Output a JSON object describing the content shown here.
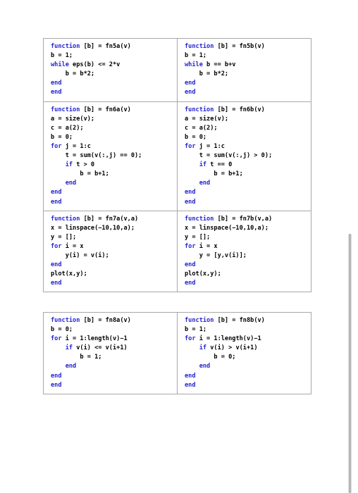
{
  "document": {
    "kind": "matlab-code-comparison-sheet",
    "background_color": "#ffffff",
    "keyword_color": "#2323cf",
    "text_color": "#000000",
    "border_color": "#a8a8a8"
  },
  "tables": {
    "upper": {
      "rows": [
        {
          "left": {
            "name": "fn5a",
            "lines": [
              {
                "segments": [
                  {
                    "t": "function",
                    "kw": true
                  },
                  {
                    "t": " [b] = fn5a(v)",
                    "kw": false
                  }
                ]
              },
              {
                "segments": [
                  {
                    "t": "b = 1;",
                    "kw": false
                  }
                ]
              },
              {
                "segments": [
                  {
                    "t": "while",
                    "kw": true
                  },
                  {
                    "t": " eps(b) <= 2*v",
                    "kw": false
                  }
                ]
              },
              {
                "segments": [
                  {
                    "t": "    b = b*2;",
                    "kw": false
                  }
                ]
              },
              {
                "segments": [
                  {
                    "t": "end",
                    "kw": true
                  }
                ]
              },
              {
                "segments": [
                  {
                    "t": "end",
                    "kw": true
                  }
                ]
              }
            ]
          },
          "right": {
            "name": "fn5b",
            "lines": [
              {
                "segments": [
                  {
                    "t": "function",
                    "kw": true
                  },
                  {
                    "t": " [b] = fn5b(v)",
                    "kw": false
                  }
                ]
              },
              {
                "segments": [
                  {
                    "t": "b = 1;",
                    "kw": false
                  }
                ]
              },
              {
                "segments": [
                  {
                    "t": "while",
                    "kw": true
                  },
                  {
                    "t": " b == b+v",
                    "kw": false
                  }
                ]
              },
              {
                "segments": [
                  {
                    "t": "    b = b*2;",
                    "kw": false
                  }
                ]
              },
              {
                "segments": [
                  {
                    "t": "end",
                    "kw": true
                  }
                ]
              },
              {
                "segments": [
                  {
                    "t": "end",
                    "kw": true
                  }
                ]
              }
            ]
          }
        },
        {
          "left": {
            "name": "fn6a",
            "lines": [
              {
                "segments": [
                  {
                    "t": "function",
                    "kw": true
                  },
                  {
                    "t": " [b] = fn6a(v)",
                    "kw": false
                  }
                ]
              },
              {
                "segments": [
                  {
                    "t": "a = size(v);",
                    "kw": false
                  }
                ]
              },
              {
                "segments": [
                  {
                    "t": "c = a(2);",
                    "kw": false
                  }
                ]
              },
              {
                "segments": [
                  {
                    "t": "b = 0;",
                    "kw": false
                  }
                ]
              },
              {
                "segments": [
                  {
                    "t": "for",
                    "kw": true
                  },
                  {
                    "t": " j = 1:c",
                    "kw": false
                  }
                ]
              },
              {
                "segments": [
                  {
                    "t": "    t = sum(v(:,j) == 0);",
                    "kw": false
                  }
                ]
              },
              {
                "segments": [
                  {
                    "t": "    ",
                    "kw": false
                  },
                  {
                    "t": "if",
                    "kw": true
                  },
                  {
                    "t": " t > 0",
                    "kw": false
                  }
                ]
              },
              {
                "segments": [
                  {
                    "t": "        b = b+1;",
                    "kw": false
                  }
                ]
              },
              {
                "segments": [
                  {
                    "t": "    ",
                    "kw": false
                  },
                  {
                    "t": "end",
                    "kw": true
                  }
                ]
              },
              {
                "segments": [
                  {
                    "t": "end",
                    "kw": true
                  }
                ]
              },
              {
                "segments": [
                  {
                    "t": "end",
                    "kw": true
                  }
                ]
              }
            ]
          },
          "right": {
            "name": "fn6b",
            "lines": [
              {
                "segments": [
                  {
                    "t": "function",
                    "kw": true
                  },
                  {
                    "t": " [b] = fn6b(v)",
                    "kw": false
                  }
                ]
              },
              {
                "segments": [
                  {
                    "t": "a = size(v);",
                    "kw": false
                  }
                ]
              },
              {
                "segments": [
                  {
                    "t": "c = a(2);",
                    "kw": false
                  }
                ]
              },
              {
                "segments": [
                  {
                    "t": "b = 0;",
                    "kw": false
                  }
                ]
              },
              {
                "segments": [
                  {
                    "t": "for",
                    "kw": true
                  },
                  {
                    "t": " j = 1:c",
                    "kw": false
                  }
                ]
              },
              {
                "segments": [
                  {
                    "t": "    t = sum(v(:,j) > 0);",
                    "kw": false
                  }
                ]
              },
              {
                "segments": [
                  {
                    "t": "    ",
                    "kw": false
                  },
                  {
                    "t": "if",
                    "kw": true
                  },
                  {
                    "t": " t == 0",
                    "kw": false
                  }
                ]
              },
              {
                "segments": [
                  {
                    "t": "        b = b+1;",
                    "kw": false
                  }
                ]
              },
              {
                "segments": [
                  {
                    "t": "    ",
                    "kw": false
                  },
                  {
                    "t": "end",
                    "kw": true
                  }
                ]
              },
              {
                "segments": [
                  {
                    "t": "end",
                    "kw": true
                  }
                ]
              },
              {
                "segments": [
                  {
                    "t": "end",
                    "kw": true
                  }
                ]
              }
            ]
          }
        },
        {
          "left": {
            "name": "fn7a",
            "lines": [
              {
                "segments": [
                  {
                    "t": "function",
                    "kw": true
                  },
                  {
                    "t": " [b] = fn7a(v,a)",
                    "kw": false
                  }
                ]
              },
              {
                "segments": [
                  {
                    "t": "x = linspace(−10,10,a);",
                    "kw": false
                  }
                ]
              },
              {
                "segments": [
                  {
                    "t": "y = [];",
                    "kw": false
                  }
                ]
              },
              {
                "segments": [
                  {
                    "t": "for",
                    "kw": true
                  },
                  {
                    "t": " i = x",
                    "kw": false
                  }
                ]
              },
              {
                "segments": [
                  {
                    "t": "    y(i) = v(i);",
                    "kw": false
                  }
                ]
              },
              {
                "segments": [
                  {
                    "t": "end",
                    "kw": true
                  }
                ]
              },
              {
                "segments": [
                  {
                    "t": "plot(x,y);",
                    "kw": false
                  }
                ]
              },
              {
                "segments": [
                  {
                    "t": "end",
                    "kw": true
                  }
                ]
              }
            ]
          },
          "right": {
            "name": "fn7b",
            "lines": [
              {
                "segments": [
                  {
                    "t": "function",
                    "kw": true
                  },
                  {
                    "t": " [b] = fn7b(v,a)",
                    "kw": false
                  }
                ]
              },
              {
                "segments": [
                  {
                    "t": "x = linspace(−10,10,a);",
                    "kw": false
                  }
                ]
              },
              {
                "segments": [
                  {
                    "t": "y = [];",
                    "kw": false
                  }
                ]
              },
              {
                "segments": [
                  {
                    "t": "for",
                    "kw": true
                  },
                  {
                    "t": " i = x",
                    "kw": false
                  }
                ]
              },
              {
                "segments": [
                  {
                    "t": "    y = [y,v(i)];",
                    "kw": false
                  }
                ]
              },
              {
                "segments": [
                  {
                    "t": "end",
                    "kw": true
                  }
                ]
              },
              {
                "segments": [
                  {
                    "t": "plot(x,y);",
                    "kw": false
                  }
                ]
              },
              {
                "segments": [
                  {
                    "t": "end",
                    "kw": true
                  }
                ]
              }
            ]
          }
        }
      ]
    },
    "lower": {
      "rows": [
        {
          "left": {
            "name": "fn8a",
            "lines": [
              {
                "segments": [
                  {
                    "t": "function",
                    "kw": true
                  },
                  {
                    "t": " [b] = fn8a(v)",
                    "kw": false
                  }
                ]
              },
              {
                "segments": [
                  {
                    "t": "b = 0;",
                    "kw": false
                  }
                ]
              },
              {
                "segments": [
                  {
                    "t": "for",
                    "kw": true
                  },
                  {
                    "t": " i = 1:length(v)−1",
                    "kw": false
                  }
                ]
              },
              {
                "segments": [
                  {
                    "t": "    ",
                    "kw": false
                  },
                  {
                    "t": "if",
                    "kw": true
                  },
                  {
                    "t": " v(i) <= v(i+1)",
                    "kw": false
                  }
                ]
              },
              {
                "segments": [
                  {
                    "t": "        b = 1;",
                    "kw": false
                  }
                ]
              },
              {
                "segments": [
                  {
                    "t": "    ",
                    "kw": false
                  },
                  {
                    "t": "end",
                    "kw": true
                  }
                ]
              },
              {
                "segments": [
                  {
                    "t": "end",
                    "kw": true
                  }
                ]
              },
              {
                "segments": [
                  {
                    "t": "end",
                    "kw": true
                  }
                ]
              }
            ]
          },
          "right": {
            "name": "fn8b",
            "lines": [
              {
                "segments": [
                  {
                    "t": "function",
                    "kw": true
                  },
                  {
                    "t": " [b] = fn8b(v)",
                    "kw": false
                  }
                ]
              },
              {
                "segments": [
                  {
                    "t": "b = 1;",
                    "kw": false
                  }
                ]
              },
              {
                "segments": [
                  {
                    "t": "for",
                    "kw": true
                  },
                  {
                    "t": " i = 1:length(v)−1",
                    "kw": false
                  }
                ]
              },
              {
                "segments": [
                  {
                    "t": "    ",
                    "kw": false
                  },
                  {
                    "t": "if",
                    "kw": true
                  },
                  {
                    "t": " v(i) > v(i+1)",
                    "kw": false
                  }
                ]
              },
              {
                "segments": [
                  {
                    "t": "        b = 0;",
                    "kw": false
                  }
                ]
              },
              {
                "segments": [
                  {
                    "t": "    ",
                    "kw": false
                  },
                  {
                    "t": "end",
                    "kw": true
                  }
                ]
              },
              {
                "segments": [
                  {
                    "t": "end",
                    "kw": true
                  }
                ]
              },
              {
                "segments": [
                  {
                    "t": "end",
                    "kw": true
                  }
                ]
              }
            ]
          }
        }
      ]
    }
  },
  "scrollbar": {
    "name": "vertical-scrollbar",
    "orientation": "vertical"
  }
}
